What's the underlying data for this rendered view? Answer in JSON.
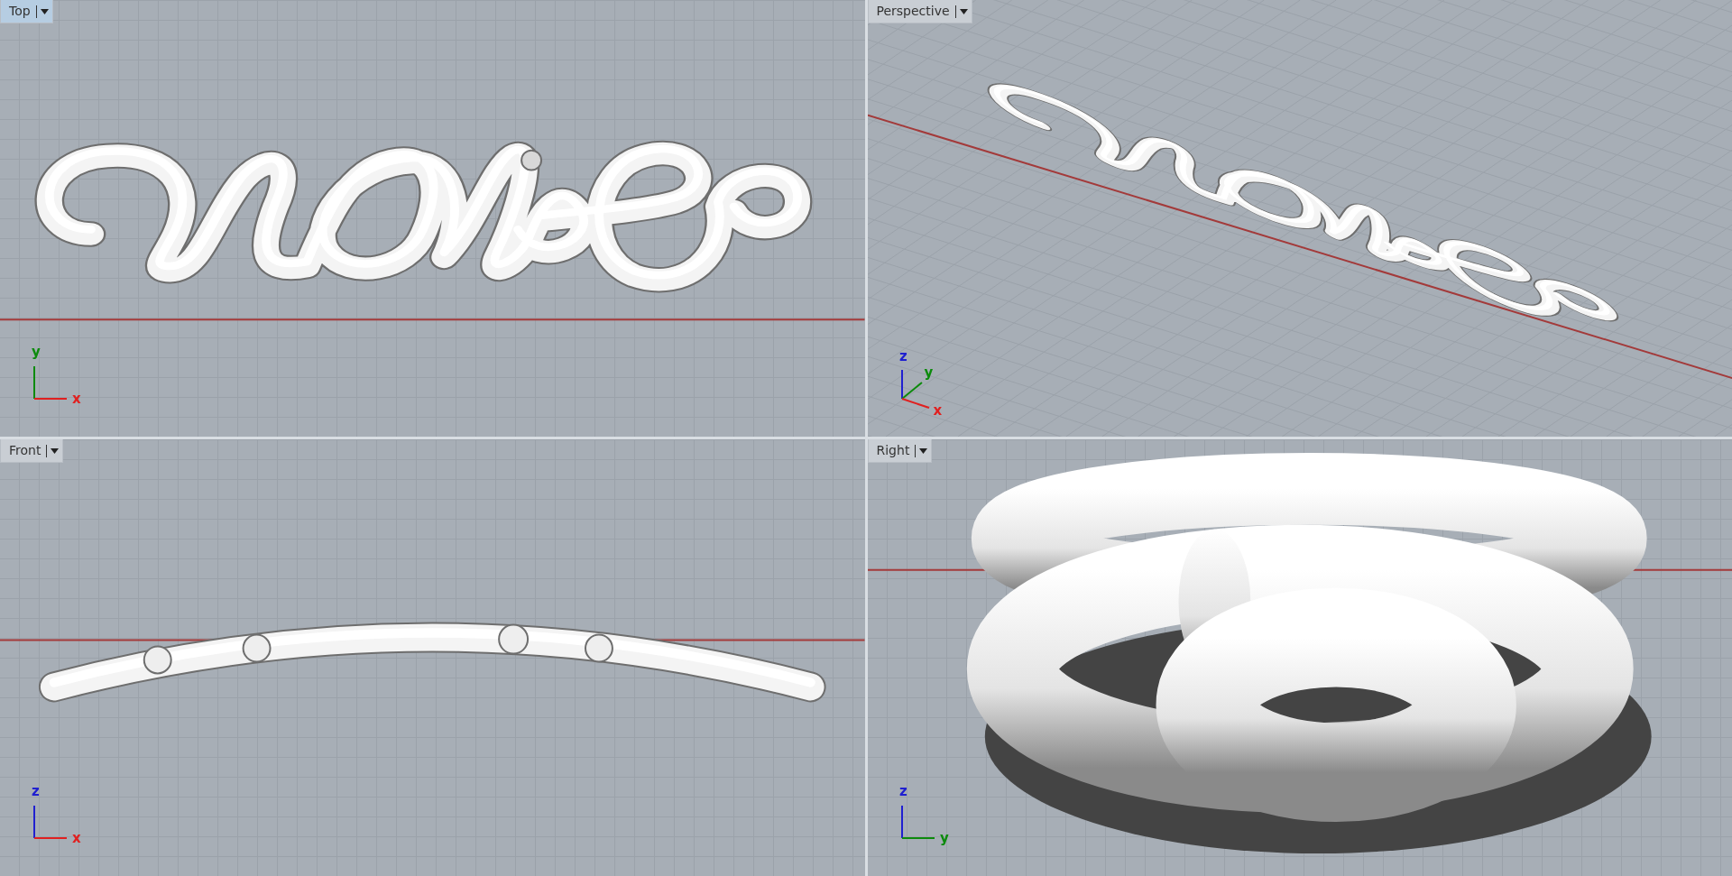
{
  "viewports": [
    {
      "title": "Top",
      "selected": true,
      "kind": "top",
      "axes": [
        {
          "label": "y",
          "color": "#0c8a0c"
        },
        {
          "label": "x",
          "color": "#e02020"
        }
      ]
    },
    {
      "title": "Perspective",
      "selected": false,
      "kind": "perspective",
      "axes": [
        {
          "label": "z",
          "color": "#2020d0"
        },
        {
          "label": "y",
          "color": "#0c8a0c"
        },
        {
          "label": "x",
          "color": "#e02020"
        }
      ]
    },
    {
      "title": "Front",
      "selected": false,
      "kind": "front",
      "axes": [
        {
          "label": "z",
          "color": "#2020d0"
        },
        {
          "label": "x",
          "color": "#e02020"
        }
      ]
    },
    {
      "title": "Right",
      "selected": false,
      "kind": "right",
      "axes": [
        {
          "label": "z",
          "color": "#2020d0"
        },
        {
          "label": "y",
          "color": "#0c8a0c"
        }
      ]
    }
  ]
}
